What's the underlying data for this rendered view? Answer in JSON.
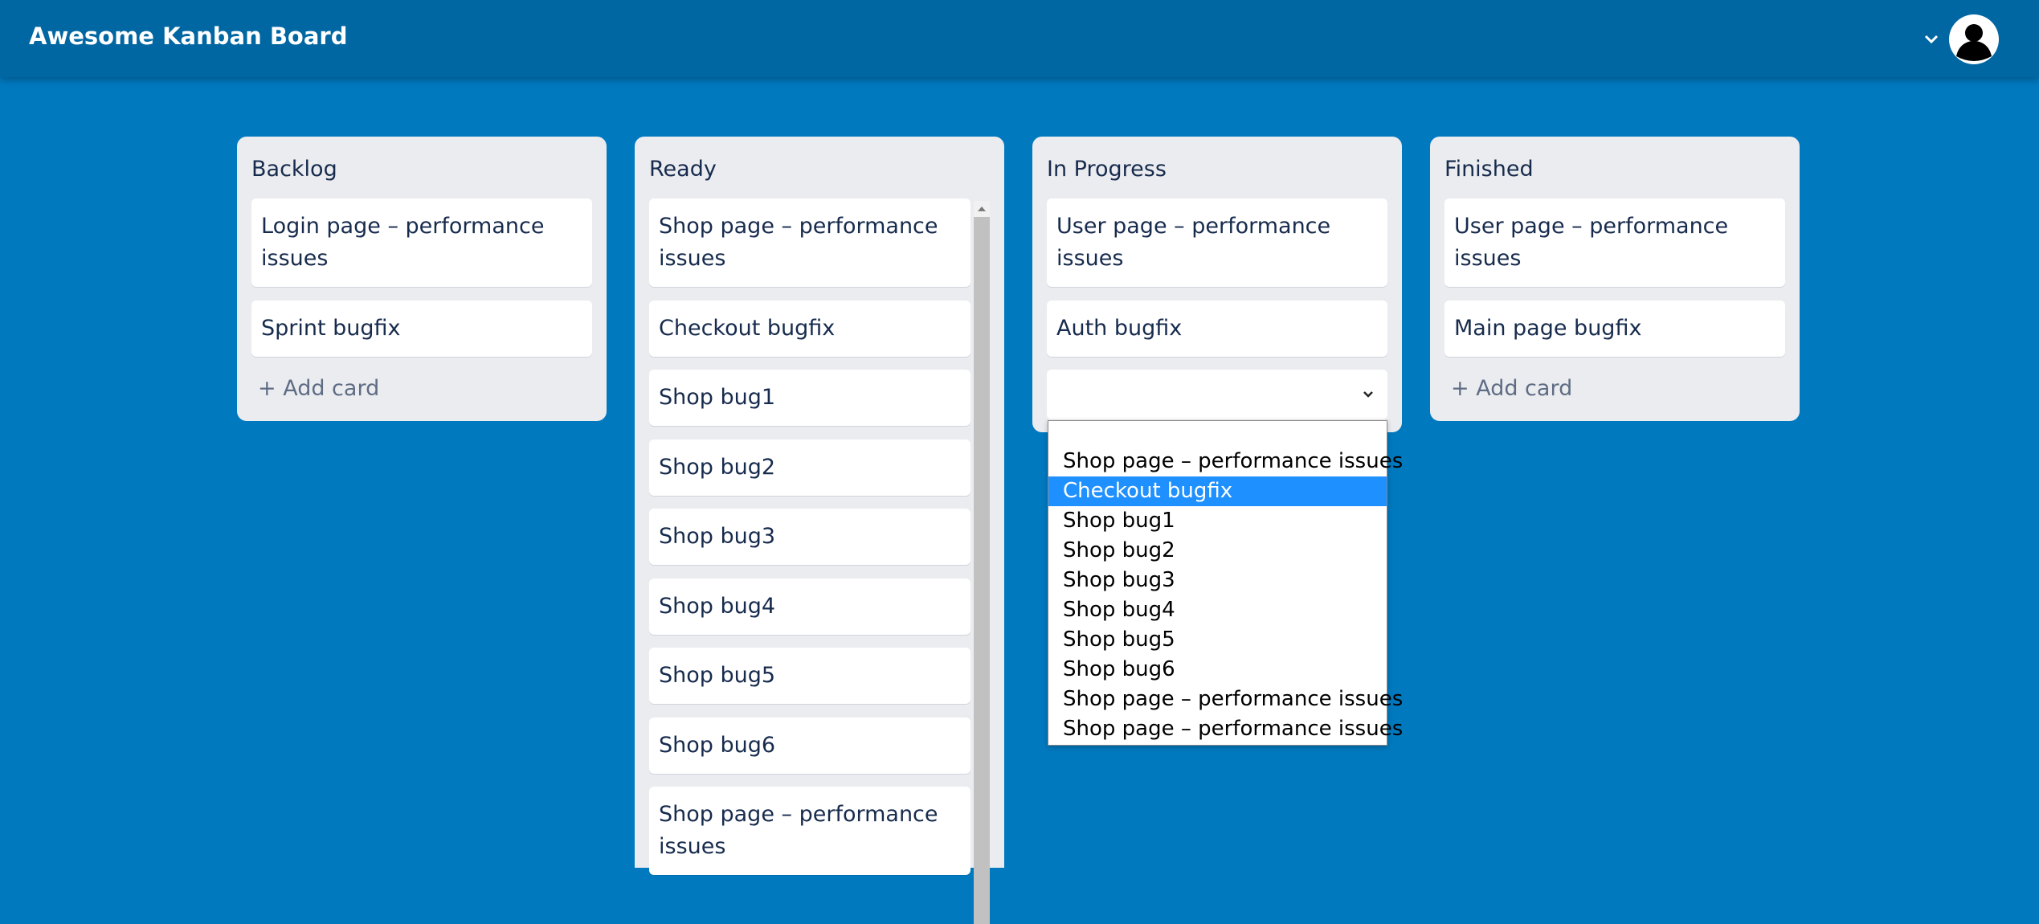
{
  "header": {
    "title": "Awesome Kanban Board"
  },
  "colors": {
    "background": "#0079bf",
    "header": "#0067a3",
    "column": "#ebecf0",
    "selected_option": "#1e90ff"
  },
  "columns": [
    {
      "title": "Backlog",
      "cards": [
        "Login page – performance issues",
        "Sprint bugfix"
      ],
      "add_card": "+ Add card"
    },
    {
      "title": "Ready",
      "cards": [
        "Shop page – performance issues",
        "Checkout bugfix",
        "Shop bug1",
        "Shop bug2",
        "Shop bug3",
        "Shop bug4",
        "Shop bug5",
        "Shop bug6",
        "Shop page – performance issues"
      ]
    },
    {
      "title": "In Progress",
      "cards": [
        "User page – performance issues",
        "Auth bugfix"
      ],
      "select_value": ""
    },
    {
      "title": "Finished",
      "cards": [
        "User page – performance issues",
        "Main page bugfix"
      ],
      "add_card": "+ Add card"
    }
  ],
  "dropdown": {
    "selected_index": 1,
    "options": [
      "Shop page – performance issues",
      "Checkout bugfix",
      "Shop bug1",
      "Shop bug2",
      "Shop bug3",
      "Shop bug4",
      "Shop bug5",
      "Shop bug6",
      "Shop page – performance issues",
      "Shop page – performance issues"
    ]
  }
}
